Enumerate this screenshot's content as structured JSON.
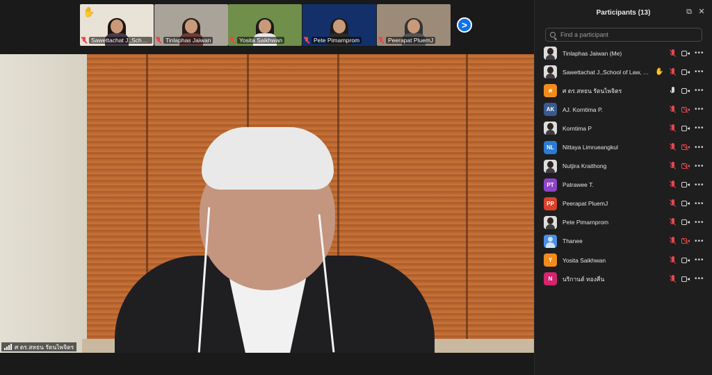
{
  "thumbnails": [
    {
      "name": "Sawettachat J.,School ...",
      "hand_raised": true,
      "muted": true,
      "scene": "#e9e2d6",
      "hair": "#1c1410",
      "torso": "#4a3b4a"
    },
    {
      "name": "Tinlaphas Jaiwan",
      "hand_raised": false,
      "muted": true,
      "scene": "#a9a39a",
      "hair": "#2a1d18",
      "torso": "#6b3d3a"
    },
    {
      "name": "Yosita Saikhwan",
      "hand_raised": false,
      "muted": true,
      "scene": "#6f8f4a",
      "hair": "#1a1a1a",
      "torso": "#e8e8e8"
    },
    {
      "name": "Pete Pimarnprom",
      "hand_raised": false,
      "muted": true,
      "scene": "#14306b",
      "hair": "#1b1b1b",
      "torso": "#2a2a2a"
    },
    {
      "name": "Peerapat PluemJ",
      "hand_raised": false,
      "muted": true,
      "scene": "#9b8b78",
      "hair": "#333",
      "torso": "#555"
    }
  ],
  "next_button": ">",
  "speaker": {
    "name": "ศ ดร.สหธน รัตนไพจิตร"
  },
  "panel": {
    "title": "Participants (13)",
    "popout_icon": "popout-icon",
    "close_icon": "close-icon",
    "search_placeholder": "Find a participant"
  },
  "participants": [
    {
      "name": "Tinlaphas Jaiwan (Me)",
      "avatar_type": "photo",
      "initials": "",
      "color": "",
      "hand": false,
      "mic": "off",
      "cam": "on"
    },
    {
      "name": "Sawettachat J.,School of Law, Wal...",
      "avatar_type": "photo",
      "initials": "",
      "color": "",
      "hand": true,
      "mic": "off",
      "cam": "on"
    },
    {
      "name": "ศ ดร.สหธน รัตนไพจิตร",
      "avatar_type": "initial",
      "initials": "ศ",
      "color": "#f28c1d",
      "hand": false,
      "mic": "on",
      "cam": "on"
    },
    {
      "name": "AJ. Korntima P.",
      "avatar_type": "initial",
      "initials": "AK",
      "color": "#3a5a8c",
      "hand": false,
      "mic": "off",
      "cam": "off"
    },
    {
      "name": "Korntima P",
      "avatar_type": "photo",
      "initials": "",
      "color": "",
      "hand": false,
      "mic": "off",
      "cam": "on"
    },
    {
      "name": "Nittaya Limrueangkul",
      "avatar_type": "initial",
      "initials": "NL",
      "color": "#2a7bd4",
      "hand": false,
      "mic": "off",
      "cam": "off"
    },
    {
      "name": "Nutjira Kraithong",
      "avatar_type": "photo",
      "initials": "",
      "color": "",
      "hand": false,
      "mic": "off",
      "cam": "off"
    },
    {
      "name": "Patrawee T.",
      "avatar_type": "initial",
      "initials": "PT",
      "color": "#8e44c9",
      "hand": false,
      "mic": "off",
      "cam": "on"
    },
    {
      "name": "Peerapat PluemJ",
      "avatar_type": "initial",
      "initials": "PP",
      "color": "#d9412b",
      "hand": false,
      "mic": "off",
      "cam": "on"
    },
    {
      "name": "Pete Pimarnprom",
      "avatar_type": "photo",
      "initials": "",
      "color": "",
      "hand": false,
      "mic": "off",
      "cam": "on"
    },
    {
      "name": "Thanee",
      "avatar_type": "generic",
      "initials": "",
      "color": "#4a8fe7",
      "hand": false,
      "mic": "off",
      "cam": "off"
    },
    {
      "name": "Yosita Saikhwan",
      "avatar_type": "initial",
      "initials": "Y",
      "color": "#f28c1d",
      "hand": false,
      "mic": "off",
      "cam": "on"
    },
    {
      "name": "นริกานต์ ทองคืน",
      "avatar_type": "initial",
      "initials": "N",
      "color": "#d6246e",
      "hand": false,
      "mic": "off",
      "cam": "on"
    }
  ],
  "colors": {
    "accent": "#0e72ed",
    "muted_red": "#e5484d",
    "raised_hand": "#f5c542"
  }
}
